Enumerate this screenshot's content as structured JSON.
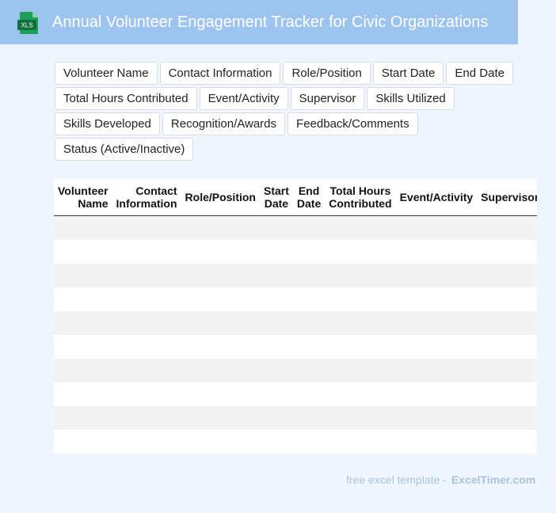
{
  "header": {
    "file_icon_text": "XLS",
    "title": "Annual Volunteer Engagement Tracker for Civic Organizations"
  },
  "tags": [
    [
      "Volunteer Name",
      "Contact Information",
      "Role/Position",
      "Start Date",
      "End Date"
    ],
    [
      "Total Hours Contributed",
      "Event/Activity",
      "Supervisor",
      "Skills Utilized"
    ],
    [
      "Skills Developed",
      "Recognition/Awards",
      "Feedback/Comments"
    ],
    [
      "Status (Active/Inactive)"
    ]
  ],
  "table": {
    "columns": [
      [
        "Volunteer",
        "Name"
      ],
      [
        "Contact",
        "Information"
      ],
      [
        "Role/Position"
      ],
      [
        "Start",
        "Date"
      ],
      [
        "End",
        "Date"
      ],
      [
        "Total Hours",
        "Contributed"
      ],
      [
        "Event/Activity"
      ],
      [
        "Supervisor"
      ]
    ],
    "rows": 10
  },
  "footer": {
    "text": "free excel template -",
    "brand": "ExcelTimer.com"
  },
  "colors": {
    "header_bg": "#9dc4ee",
    "page_bg": "#f0f6fd",
    "icon_green": "#1e9f5a",
    "icon_dark": "#10703d"
  }
}
